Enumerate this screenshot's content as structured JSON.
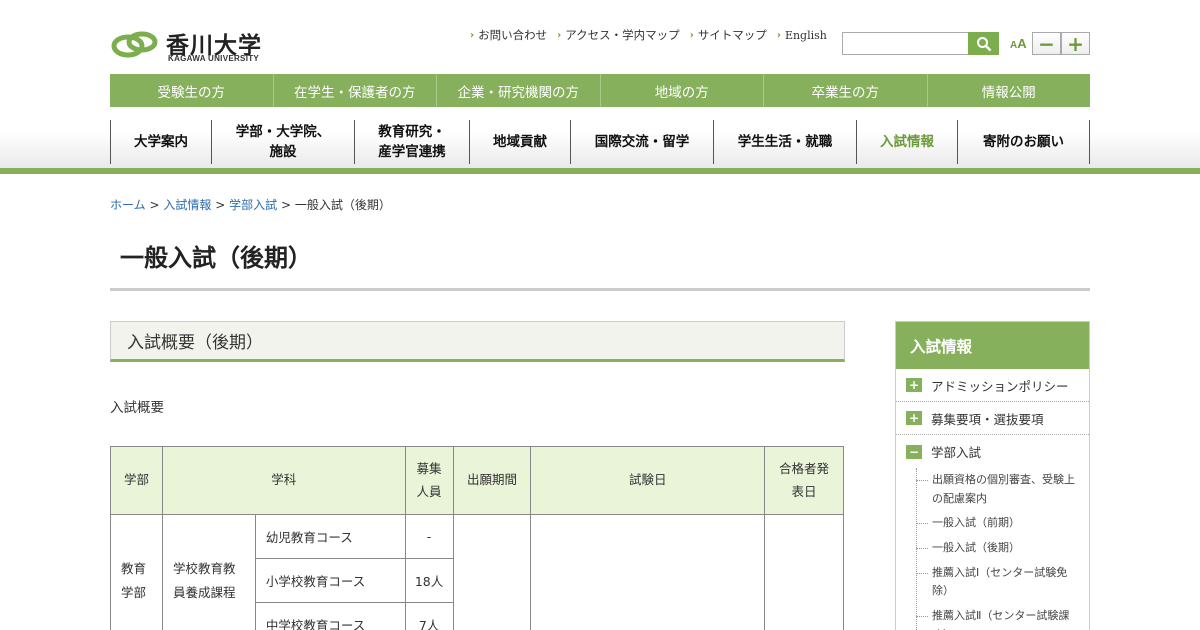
{
  "header": {
    "logo_text": "香川大学",
    "logo_sub": "KAGAWA UNIVERSITY",
    "util_links": [
      "お問い合わせ",
      "アクセス・学内マップ",
      "サイトマップ",
      "English"
    ],
    "font_label_small": "A",
    "font_label_large": "A",
    "font_minus": "−",
    "font_plus": "+"
  },
  "audience_nav": [
    "受験生の方",
    "在学生・保護者の方",
    "企業・研究機関の方",
    "地域の方",
    "卒業生の方",
    "情報公開"
  ],
  "global_nav": [
    {
      "label": "大学案内"
    },
    {
      "label": "学部・大学院、施設",
      "line1": "学部・大学院、",
      "line2": "施設"
    },
    {
      "label": "教育研究・産学官連携",
      "line1": "教育研究・",
      "line2": "産学官連携"
    },
    {
      "label": "地域貢献"
    },
    {
      "label": "国際交流・留学"
    },
    {
      "label": "学生生活・就職"
    },
    {
      "label": "入試情報"
    },
    {
      "label": "寄附のお願い"
    }
  ],
  "breadcrumb": {
    "home": "ホーム",
    "sep": ">",
    "level1": "入試情報",
    "level2": "学部入試",
    "current": "一般入試（後期）"
  },
  "page_title": "一般入試（後期）",
  "main": {
    "section_title": "入試概要（後期）",
    "sub_label": "入試概要",
    "table": {
      "headers": {
        "faculty": "学部",
        "department": "学科",
        "capacity_l1": "募集",
        "capacity_l2": "人員",
        "application": "出願期間",
        "exam_date": "試験日",
        "announce_l1": "合格者発",
        "announce_l2": "表日"
      },
      "faculty_l1": "教育",
      "faculty_l2": "学部",
      "dept_l1": "学校教育教",
      "dept_l2": "員養成課程",
      "rows": [
        {
          "course": "幼児教育コース",
          "capacity": "-"
        },
        {
          "course": "小学校教育コース",
          "capacity": "18人"
        },
        {
          "course": "中学校教育コース",
          "capacity": "7人"
        }
      ]
    }
  },
  "sidebar": {
    "title": "入試情報",
    "items": [
      {
        "label": "アドミッションポリシー",
        "toggle": "+"
      },
      {
        "label": "募集要項・選抜要項",
        "toggle": "+"
      },
      {
        "label": "学部入試",
        "toggle": "−"
      }
    ],
    "sub_items": [
      "出願資格の個別審査、受験上の配慮案内",
      "一般入試（前期）",
      "一般入試（後期）",
      "推薦入試Ⅰ（センター試験免除）",
      "推薦入試Ⅱ（センター試験課す）"
    ]
  },
  "colors": {
    "brand_green": "#86b05c",
    "link_blue": "#2b6cb0",
    "table_head_bg": "#e9f4d9"
  }
}
